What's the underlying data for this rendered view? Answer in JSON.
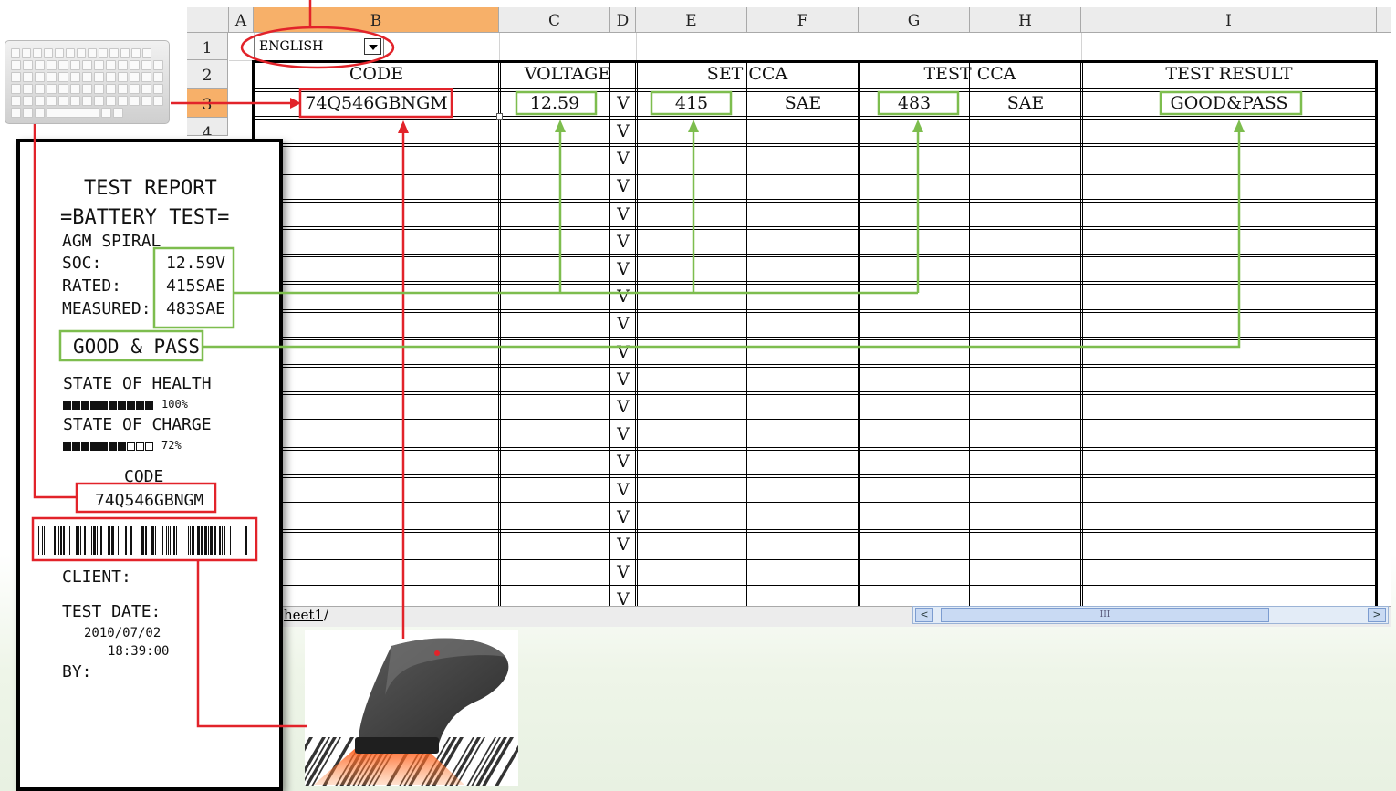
{
  "dropdown": {
    "value": "ENGLISH"
  },
  "sheet": {
    "col_headers": [
      "A",
      "B",
      "C",
      "D",
      "E",
      "F",
      "G",
      "H",
      "I"
    ],
    "row_numbers": [
      "1",
      "2",
      "3",
      "4"
    ],
    "headers": {
      "code": "CODE",
      "voltage": "VOLTAGE",
      "set_cca": "SET CCA",
      "test_cca": "TEST CCA",
      "test_result": "TEST RESULT"
    },
    "row3": {
      "code": "74Q546GBNGM",
      "voltage": "12.59",
      "unit_v": "V",
      "set_cca": "415",
      "set_unit": "SAE",
      "test_cca": "483",
      "test_unit": "SAE",
      "result": "GOOD&PASS"
    },
    "v_unit": "V",
    "tab_label": "heet1",
    "tab_sep": "/",
    "scroll_left": "<",
    "scroll_right": ">",
    "scroll_thumb": "III"
  },
  "receipt": {
    "title": "TEST REPORT",
    "subtitle": "=BATTERY TEST=",
    "battery_type": "AGM SPIRAL",
    "soc_label": "SOC:",
    "soc_value": "12.59V",
    "rated_label": "RATED:",
    "rated_value": "415SAE",
    "measured_label": "MEASURED:",
    "measured_value": "483SAE",
    "result": "GOOD & PASS",
    "health_label": "STATE OF HEALTH",
    "health_pct": "100%",
    "health_fraction": 1.0,
    "charge_label": "STATE OF CHARGE",
    "charge_pct": "72%",
    "charge_fraction": 0.72,
    "code_label": "CODE",
    "code_value": "74Q546GBNGM",
    "client_label": "CLIENT:",
    "date_label": "TEST DATE:",
    "date_value": "2010/07/02",
    "time_value": "18:39:00",
    "by_label": "BY:"
  },
  "colors": {
    "highlight_red": "#e2232a",
    "highlight_green": "#7dbd4e",
    "selected_header": "#f7b069"
  }
}
